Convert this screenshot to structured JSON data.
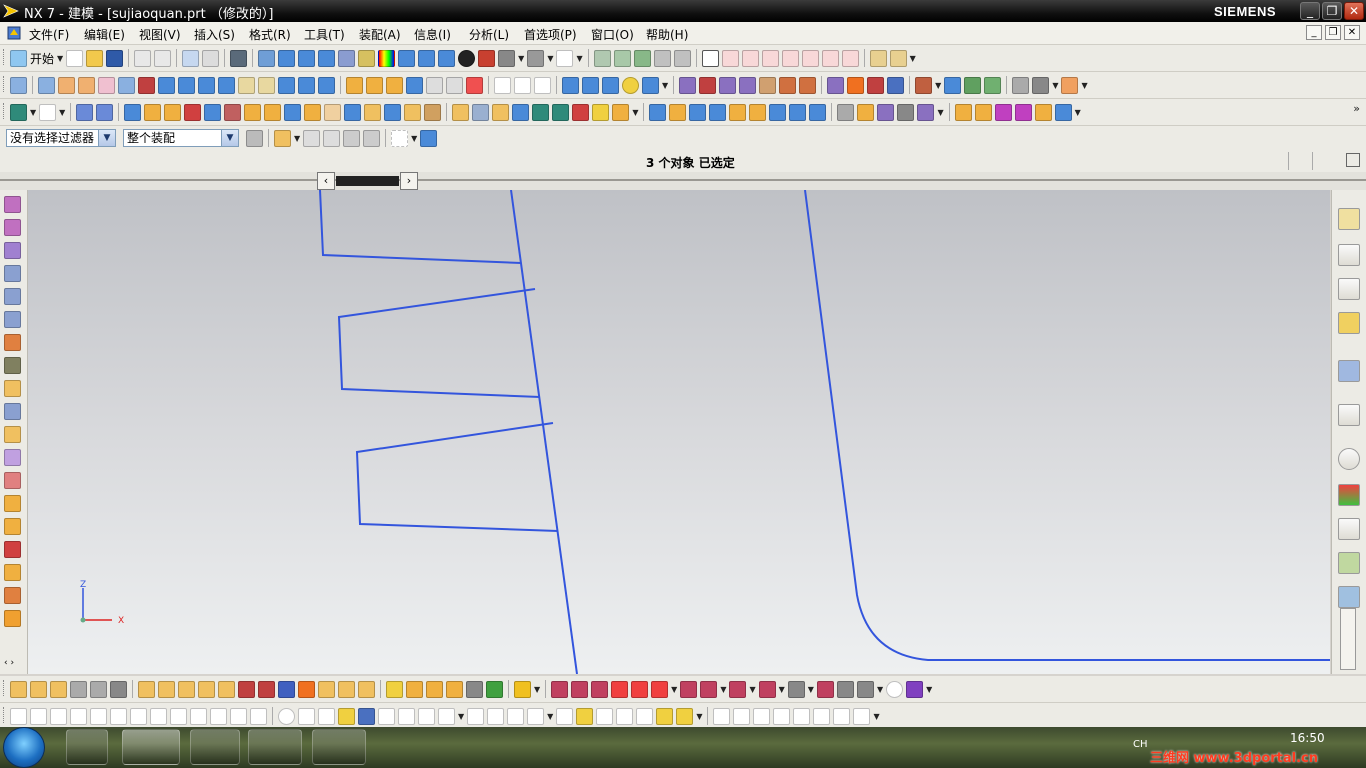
{
  "window": {
    "title": "NX 7 - 建模 - [sujiaoquan.prt （修改的）]",
    "brand": "SIEMENS",
    "minimize": "_",
    "restore": "❐",
    "close": "✕"
  },
  "menu": {
    "items": [
      "文件(F)",
      "编辑(E)",
      "视图(V)",
      "插入(S)",
      "格式(R)",
      "工具(T)",
      "装配(A)",
      "信息(I)",
      "分析(L)",
      "首选项(P)",
      "窗口(O)",
      "帮助(H)"
    ]
  },
  "toolbar1": {
    "start_label": "开始"
  },
  "selection_bar": {
    "filter_value": "没有选择过滤器",
    "scope_value": "整个装配"
  },
  "status": {
    "text": "3 个对象  已选定"
  },
  "graphics": {
    "triad_z": "Z",
    "triad_x": "X"
  },
  "taskbar": {
    "time": "16:50",
    "lang": "CH",
    "watermark": "三维网 www.3dportal.cn"
  }
}
